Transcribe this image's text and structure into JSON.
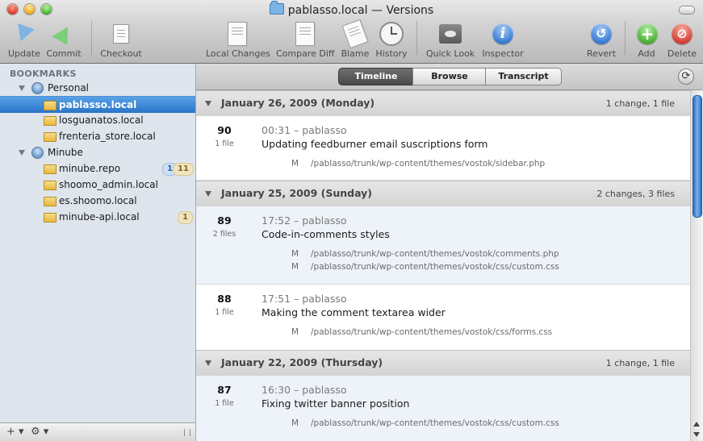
{
  "window": {
    "title": "pablasso.local — Versions"
  },
  "toolbar": {
    "update": "Update",
    "commit": "Commit",
    "checkout": "Checkout",
    "local_changes": "Local Changes",
    "compare_diff": "Compare Diff",
    "blame": "Blame",
    "history": "History",
    "quick_look": "Quick Look",
    "inspector": "Inspector",
    "revert": "Revert",
    "add": "Add",
    "delete": "Delete"
  },
  "sidebar": {
    "header": "BOOKMARKS",
    "groups": [
      {
        "label": "Personal",
        "items": [
          {
            "label": "pablasso.local",
            "selected": true
          },
          {
            "label": "losguanatos.local"
          },
          {
            "label": "frenteria_store.local"
          }
        ]
      },
      {
        "label": "Minube",
        "items": [
          {
            "label": "minube.repo",
            "badge_a": "1",
            "badge_b": "11"
          },
          {
            "label": "shoomo_admin.local"
          },
          {
            "label": "es.shoomo.local"
          },
          {
            "label": "minube-api.local",
            "badge_b": "1"
          }
        ]
      }
    ],
    "footer": {
      "add": "+",
      "gear": "⚙"
    }
  },
  "tabs": {
    "timeline": "Timeline",
    "browse": "Browse",
    "transcript": "Transcript",
    "active": "Timeline"
  },
  "timeline": {
    "days": [
      {
        "date": "January 26, 2009 (Monday)",
        "summary": "1 change, 1 file",
        "entries": [
          {
            "rev": "90",
            "files": "1 file",
            "meta": "00:31 – pablasso",
            "message": "Updating feedburner email suscriptions form",
            "changes": [
              {
                "status": "M",
                "path": "/pablasso/trunk/wp-content/themes/vostok/sidebar.php"
              }
            ]
          }
        ]
      },
      {
        "date": "January 25, 2009 (Sunday)",
        "summary": "2 changes, 3 files",
        "entries": [
          {
            "rev": "89",
            "files": "2 files",
            "meta": "17:52 – pablasso",
            "message": "Code-in-comments styles",
            "changes": [
              {
                "status": "M",
                "path": "/pablasso/trunk/wp-content/themes/vostok/comments.php"
              },
              {
                "status": "M",
                "path": "/pablasso/trunk/wp-content/themes/vostok/css/custom.css"
              }
            ]
          },
          {
            "rev": "88",
            "files": "1 file",
            "meta": "17:51 – pablasso",
            "message": "Making the comment textarea wider",
            "changes": [
              {
                "status": "M",
                "path": "/pablasso/trunk/wp-content/themes/vostok/css/forms.css"
              }
            ]
          }
        ]
      },
      {
        "date": "January 22, 2009 (Thursday)",
        "summary": "1 change, 1 file",
        "entries": [
          {
            "rev": "87",
            "files": "1 file",
            "meta": "16:30 – pablasso",
            "message": "Fixing twitter banner position",
            "changes": [
              {
                "status": "M",
                "path": "/pablasso/trunk/wp-content/themes/vostok/css/custom.css"
              }
            ]
          }
        ]
      }
    ]
  }
}
